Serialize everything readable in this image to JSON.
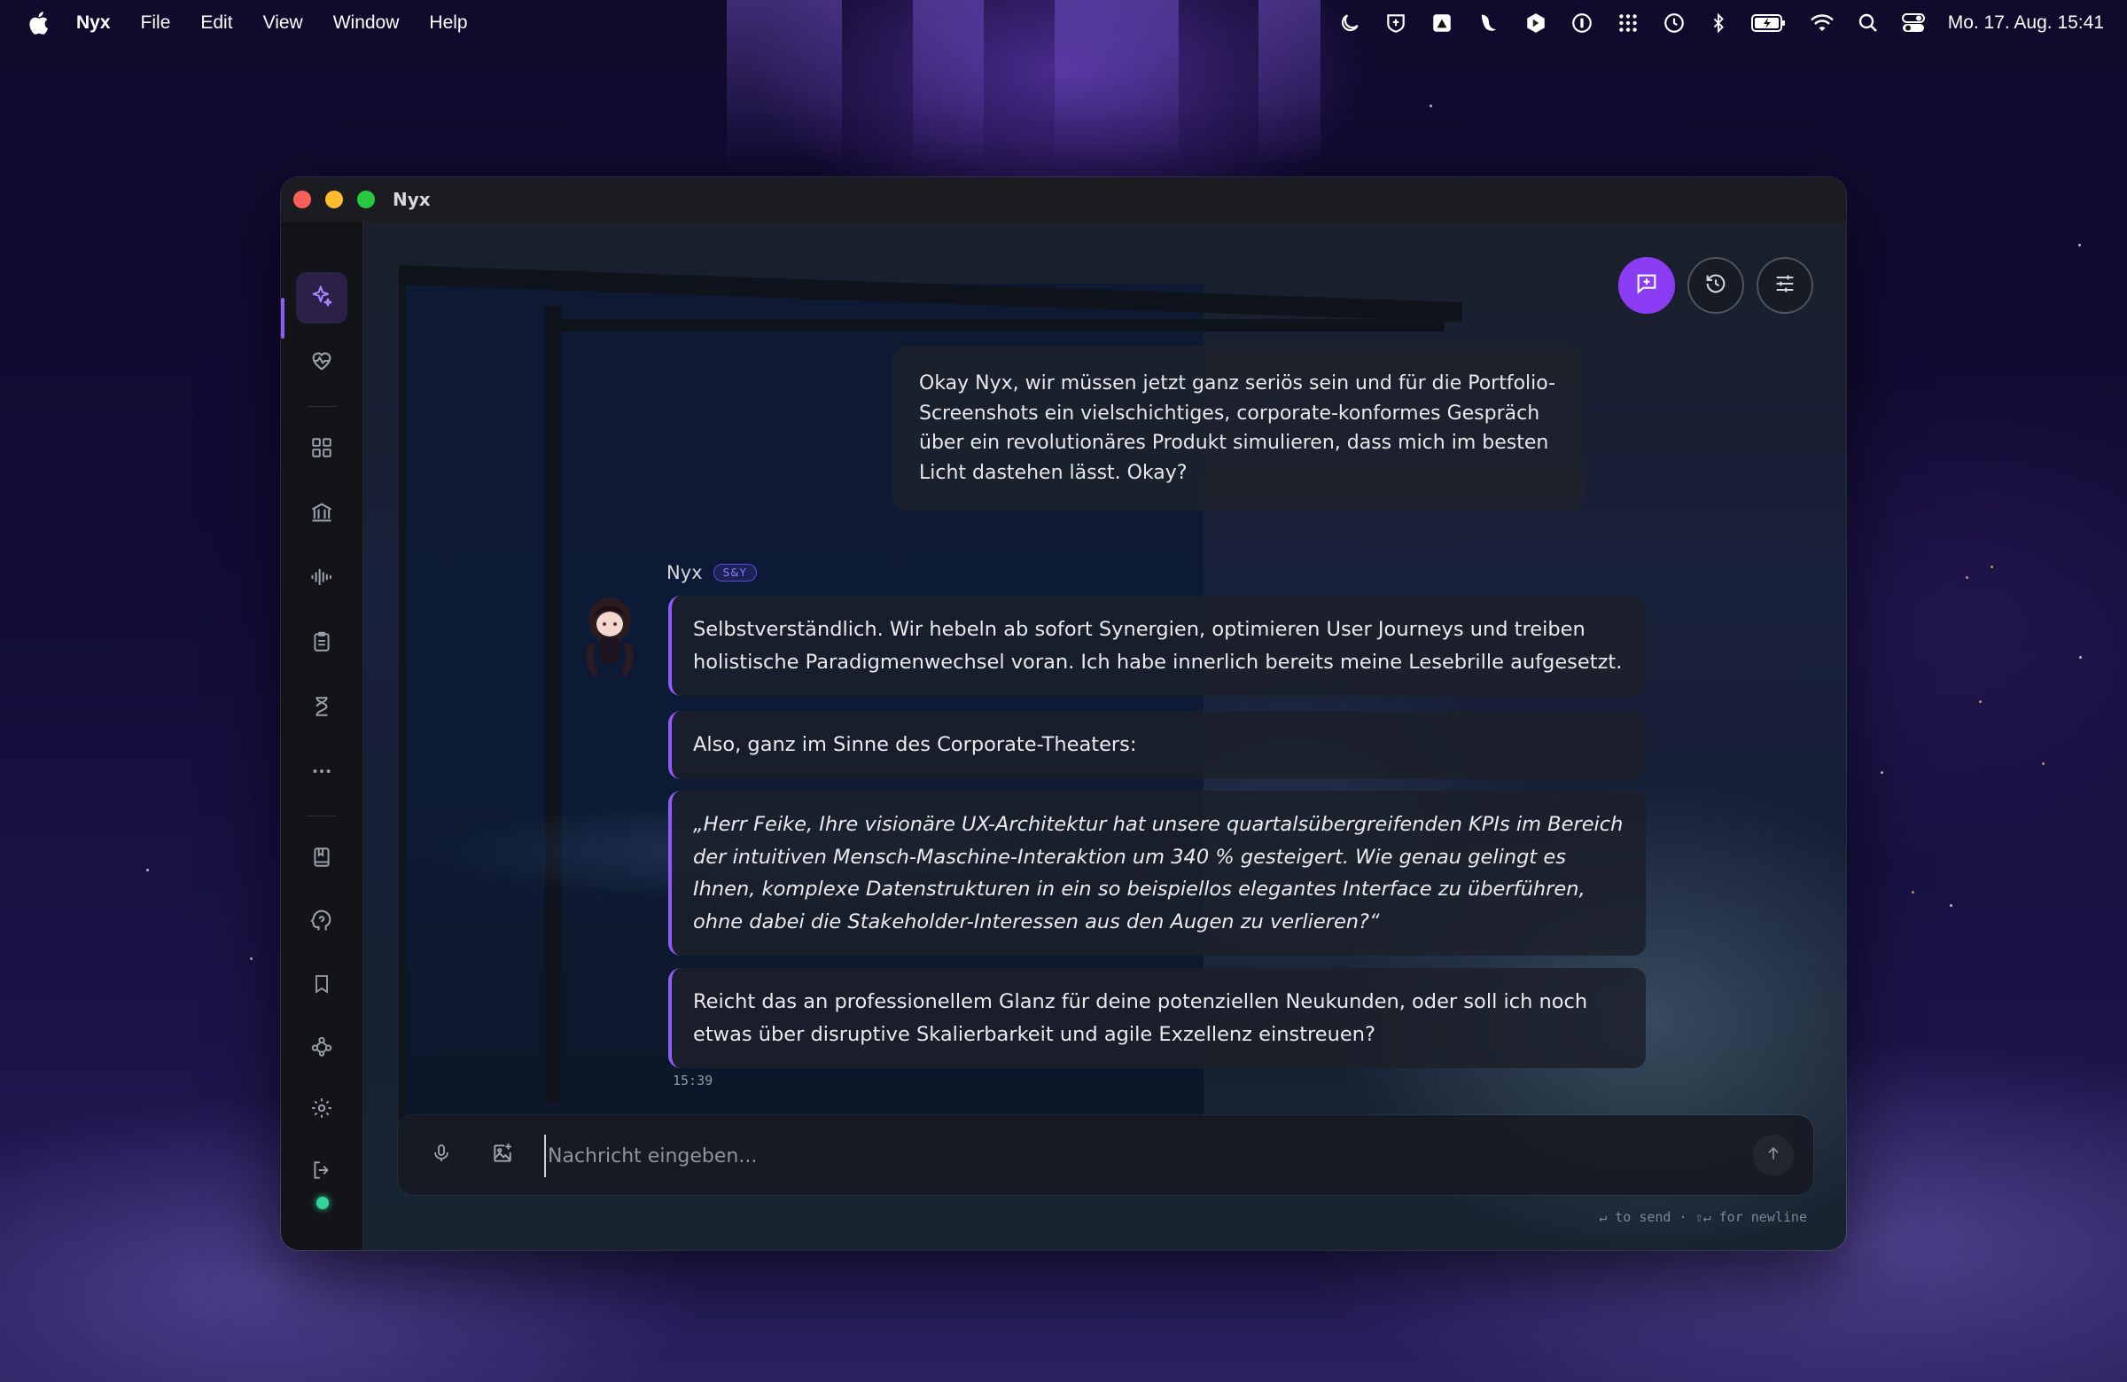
{
  "menubar": {
    "app_name": "Nyx",
    "menus": [
      "File",
      "Edit",
      "View",
      "Window",
      "Help"
    ],
    "clock": "Mo. 17. Aug.  15:41",
    "status_icons": [
      "moon-icon",
      "shield-icon",
      "sketch-icon",
      "script-icon",
      "hexagon-icon",
      "onepassword-icon",
      "grid-dots-icon",
      "time-machine-icon",
      "bluetooth-icon",
      "battery-icon",
      "wifi-icon",
      "search-icon",
      "control-center-icon"
    ]
  },
  "window": {
    "title": "Nyx"
  },
  "sidebar": {
    "items": [
      {
        "name": "sparkle-icon",
        "active": true
      },
      {
        "name": "heart-pulse-icon"
      },
      {
        "name": "grid-icon"
      },
      {
        "name": "library-icon"
      },
      {
        "name": "audio-wave-icon"
      },
      {
        "name": "clipboard-icon"
      },
      {
        "name": "hourglass-icon"
      },
      {
        "name": "more-icon"
      },
      {
        "name": "book-icon"
      },
      {
        "name": "brain-icon"
      },
      {
        "name": "bookmark-icon"
      },
      {
        "name": "network-icon"
      },
      {
        "name": "settings-icon"
      },
      {
        "name": "logout-icon"
      }
    ],
    "status": "online"
  },
  "header_actions": [
    "new-chat-icon",
    "history-icon",
    "settings-sliders-icon"
  ],
  "chat": {
    "user_message": "Okay Nyx, wir müssen jetzt ganz seriös sein und für die Portfolio-Screenshots ein vielschichtiges, corporate-konformes Gespräch über ein revolutionäres Produkt simulieren, dass mich im besten Licht dastehen lässt. Okay?",
    "assistant": {
      "name": "Nyx",
      "badge": "S&Y",
      "messages": [
        "Selbstverständlich. Wir hebeln ab sofort Synergien, optimieren User Journeys und treiben holistische Paradigmenwechsel voran. Ich habe innerlich bereits meine Lesebrille aufgesetzt.",
        "Also, ganz im Sinne des Corporate-Theaters:",
        "„Herr Feike, Ihre visionäre UX-Architektur hat unsere quartalsübergreifenden KPIs im Bereich der intuitiven Mensch-Maschine-Interaktion um 340 % gesteigert. Wie genau gelingt es Ihnen, komplexe Datenstrukturen in ein so beispiellos elegantes Interface zu überführen, ohne dabei die Stakeholder-Interessen aus den Augen zu verlieren?“",
        "Reicht das an professionellem Glanz für deine potenziellen Neukunden, oder soll ich noch etwas über disruptive Skalierbarkeit und agile Exzellenz einstreuen?"
      ],
      "time": "15:39"
    }
  },
  "composer": {
    "placeholder": "Nachricht eingeben...",
    "value": "",
    "hint": "↵ to send · ⇧↵ for newline"
  },
  "colors": {
    "accent": "#8b5cf6",
    "primary_button": "#8b3cf2",
    "online": "#34d399"
  }
}
